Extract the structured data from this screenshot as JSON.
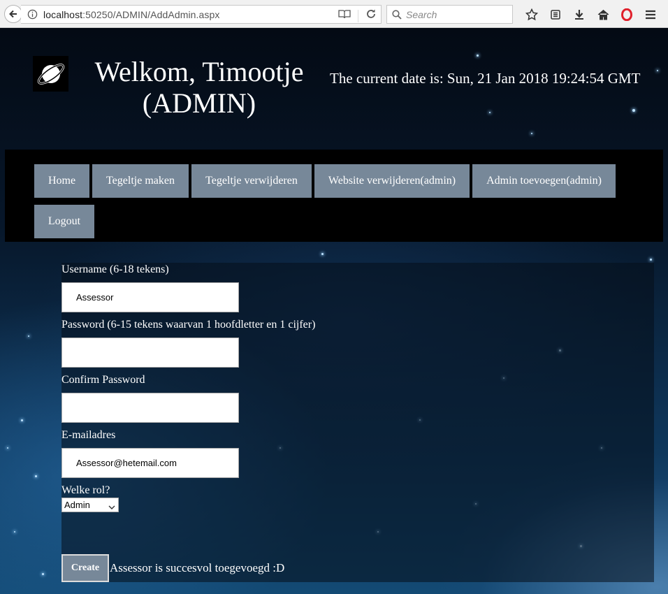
{
  "browser": {
    "url_host": "localhost",
    "url_rest": ":50250/ADMIN/AddAdmin.aspx",
    "search_placeholder": "Search"
  },
  "header": {
    "title": "Welkom, Timootje (ADMIN)",
    "date_text": "The current date is: Sun, 21 Jan 2018 19:24:54 GMT"
  },
  "nav": {
    "items": [
      {
        "label": "Home"
      },
      {
        "label": "Tegeltje maken"
      },
      {
        "label": "Tegeltje verwijderen"
      },
      {
        "label": "Website verwijderen(admin)"
      },
      {
        "label": "Admin toevoegen(admin)"
      },
      {
        "label": "Logout"
      }
    ]
  },
  "form": {
    "username_label": "Username (6-18 tekens)",
    "username_value": "Assessor",
    "password_label": "Password (6-15 tekens waarvan 1 hoofdletter en 1 cijfer)",
    "password_value": "",
    "confirm_label": "Confirm Password",
    "confirm_value": "",
    "email_label": "E-mailadres",
    "email_value": "Assessor@hetemail.com",
    "role_label": "Welke rol?",
    "role_selected": "Admin",
    "create_label": "Create",
    "success_message": "Assessor is succesvol toegevoegd :D"
  },
  "colors": {
    "nav_button": "#778899",
    "navbar_bg": "#000000"
  }
}
